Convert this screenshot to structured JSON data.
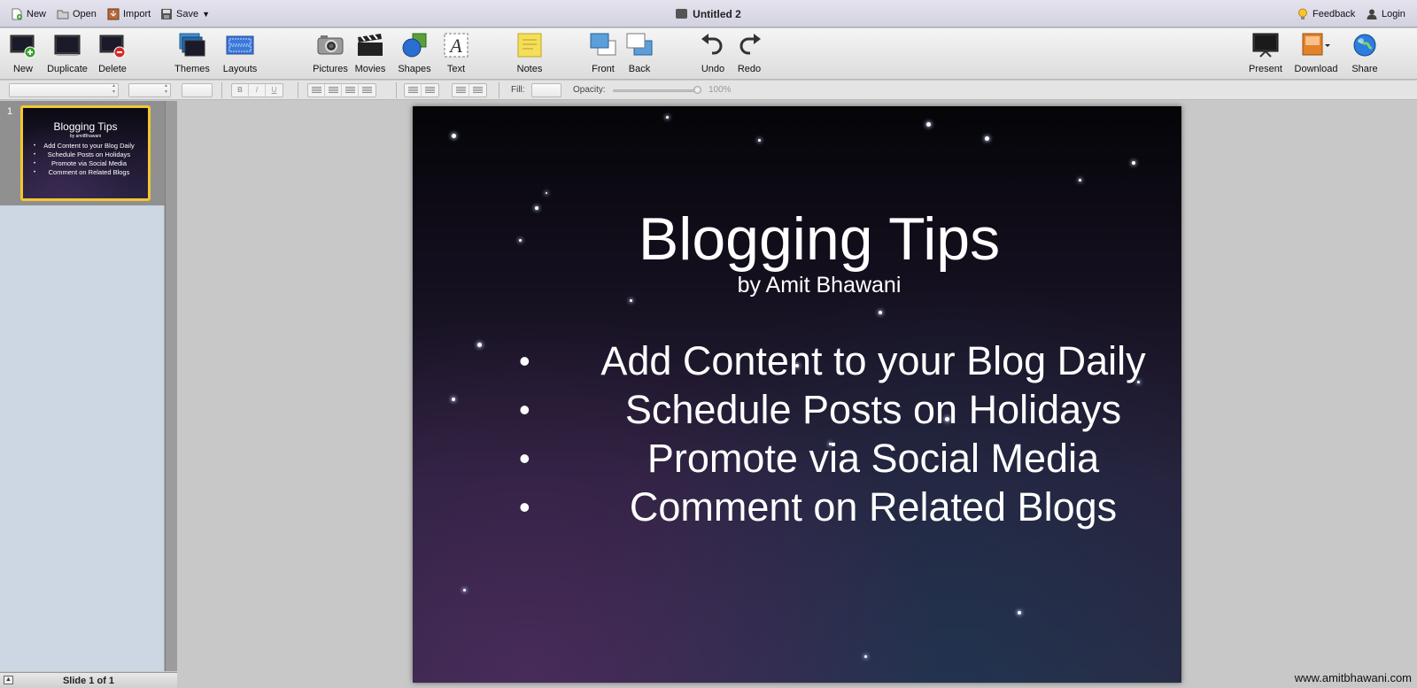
{
  "menubar": {
    "new": "New",
    "open": "Open",
    "import": "Import",
    "save": "Save",
    "title": "Untitled 2",
    "feedback": "Feedback",
    "login": "Login"
  },
  "toolbar": {
    "new": "New",
    "duplicate": "Duplicate",
    "delete": "Delete",
    "themes": "Themes",
    "layouts": "Layouts",
    "pictures": "Pictures",
    "movies": "Movies",
    "shapes": "Shapes",
    "text": "Text",
    "notes": "Notes",
    "front": "Front",
    "back": "Back",
    "undo": "Undo",
    "redo": "Redo",
    "present": "Present",
    "download": "Download",
    "share": "Share"
  },
  "formatbar": {
    "bold": "B",
    "italic": "I",
    "underline": "U",
    "fill_label": "Fill:",
    "opacity_label": "Opacity:",
    "opacity_value": "100%"
  },
  "slides_panel": {
    "slide_number": "1",
    "counter": "Slide 1 of 1",
    "selected_border_color": "#f3c62f"
  },
  "slide": {
    "title": "Blogging Tips",
    "subtitle": "by Amit Bhawani",
    "bullet_symbol": "•",
    "bullets": [
      "Add Content to your Blog Daily",
      "Schedule Posts on Holidays",
      "Promote via Social Media",
      "Comment on Related Blogs"
    ]
  },
  "thumbnail": {
    "title": "Blogging Tips",
    "subtitle": "by amitBhawani"
  },
  "watermark": "www.amitbhawani.com"
}
